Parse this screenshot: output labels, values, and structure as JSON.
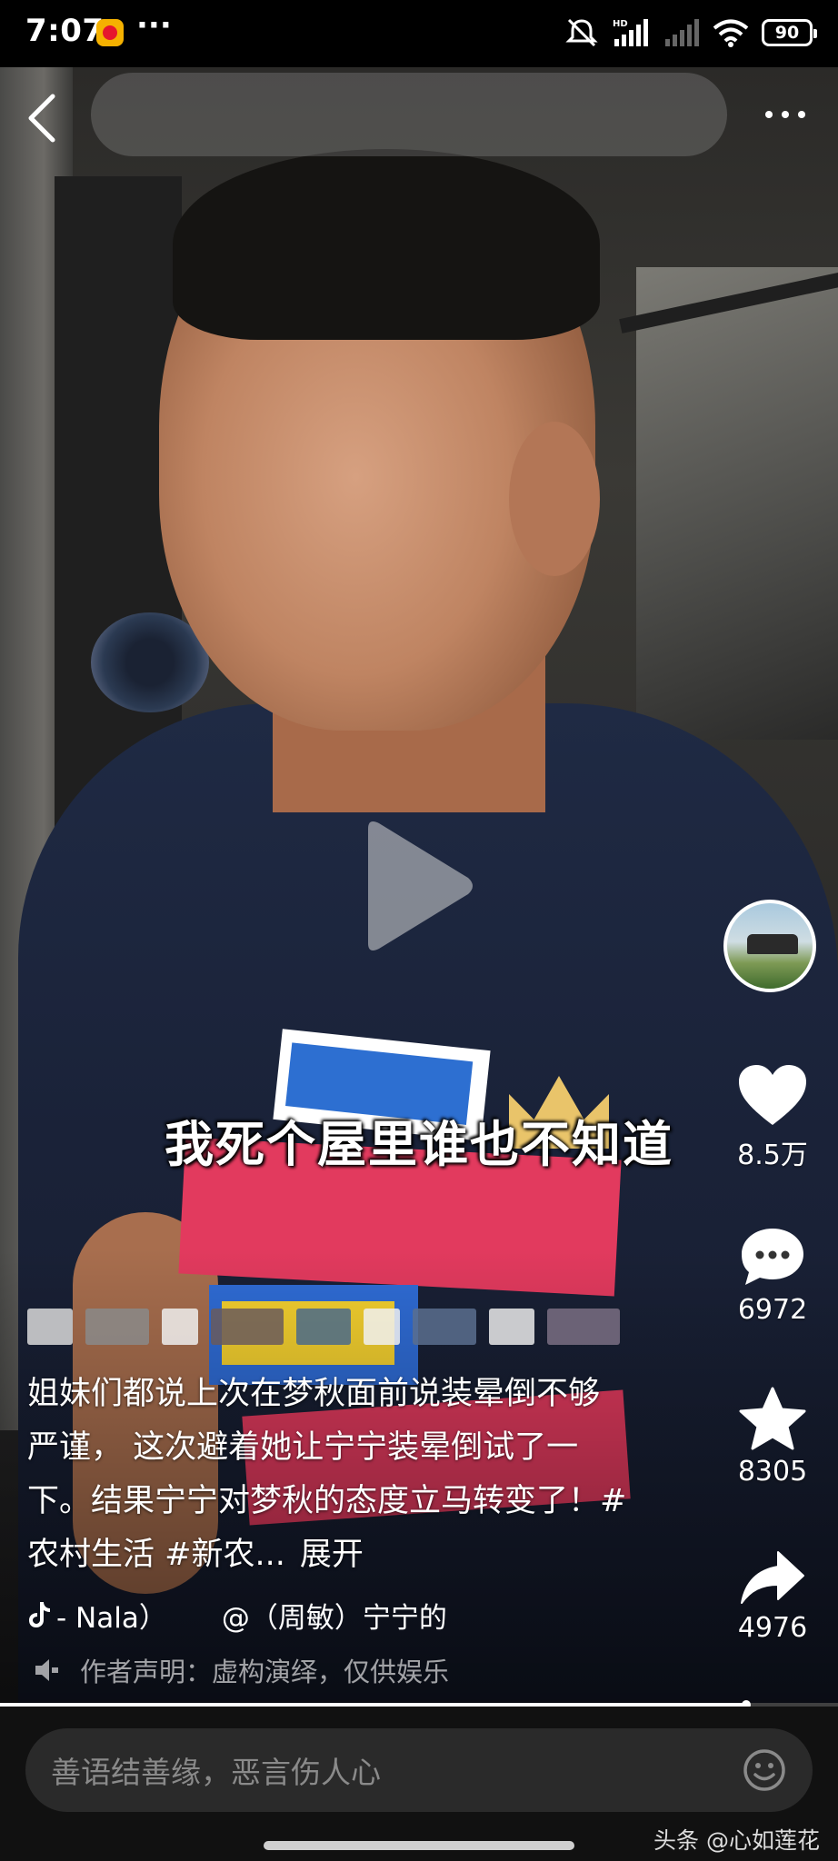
{
  "status_bar": {
    "time": "7:07",
    "more": "···",
    "network_label": "HD",
    "battery": "90"
  },
  "video": {
    "subtitle": "我死个屋里谁也不知道",
    "progress_fraction": 0.89
  },
  "side_actions": {
    "likes": "8.5万",
    "comments": "6972",
    "favorites": "8305",
    "shares": "4976"
  },
  "caption": {
    "text": "姐妹们都说上次在梦秋面前说装晕倒不够严谨， 这次避着她让宁宁装晕倒试了一下。结果宁宁对梦秋的态度立马转变了！#农村生活 #新农...",
    "expand_label": "展开",
    "music": "- Nala）",
    "mention": "@（周敏）宁宁的",
    "declaration": "作者声明：虚构演绎，仅供娱乐"
  },
  "comment_bar": {
    "placeholder": "善语结善缘，恶言伤人心",
    "watermark": "头条 @心如莲花"
  },
  "colors": {
    "background": "#000000",
    "input_bg": "#2a2a2a",
    "placeholder": "#8a8a8a"
  },
  "icons": [
    "back-icon",
    "more-icon",
    "play-icon",
    "heart-icon",
    "comment-icon",
    "star-icon",
    "share-icon",
    "tiktok-icon",
    "speaker-icon",
    "emoji-icon"
  ]
}
